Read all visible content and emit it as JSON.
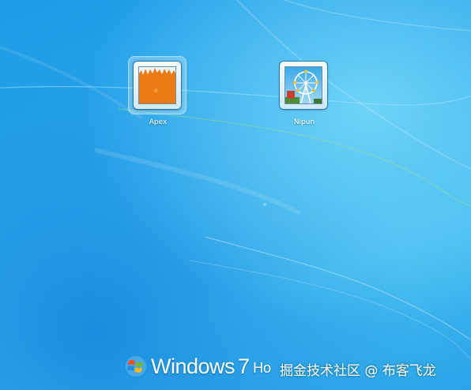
{
  "users": [
    {
      "name": "Apex",
      "picture": "orange-flames-picture",
      "selected": true
    },
    {
      "name": "Nipun",
      "picture": "ferris-wheel-picture",
      "selected": false
    }
  ],
  "branding": {
    "logo": "windows-flag-logo",
    "word": "Windows",
    "version": "7",
    "edition": "Ho"
  },
  "watermark": "掘金技术社区 @ 布客飞龙",
  "colors": {
    "background": "#2aa3e8",
    "apex_picture": "#ec7a14"
  }
}
